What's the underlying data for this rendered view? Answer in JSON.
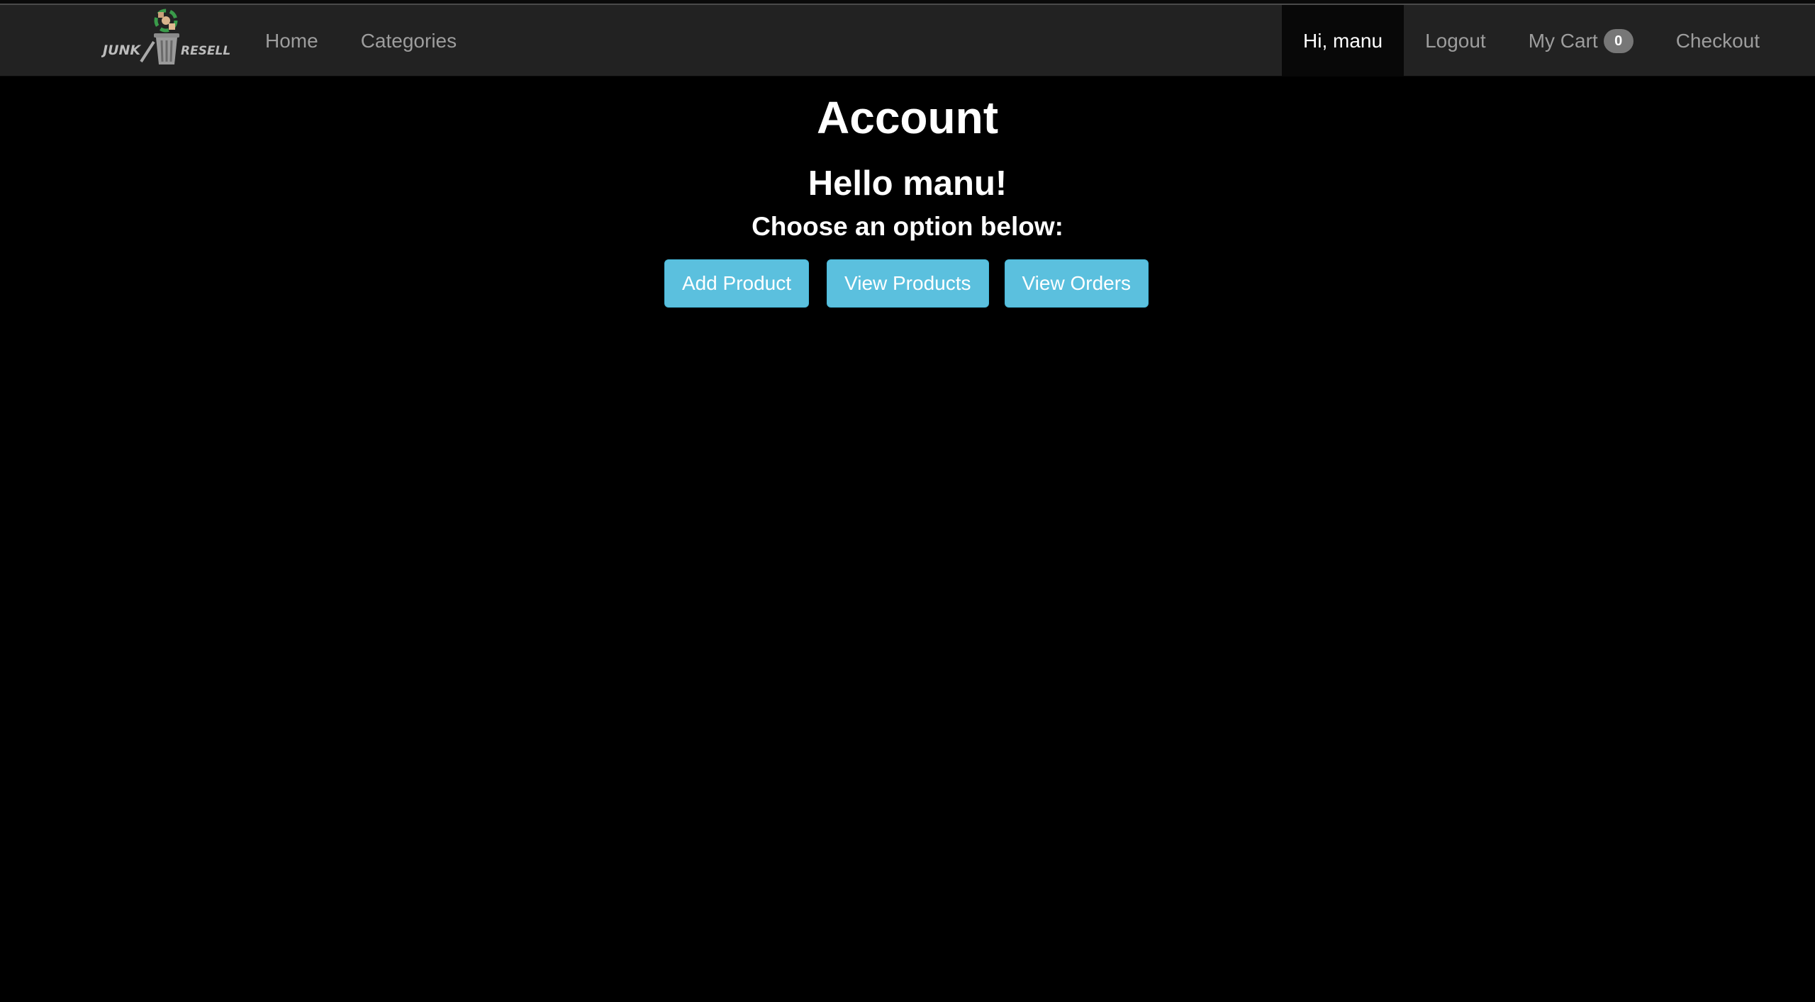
{
  "brand": {
    "logo_text_left": "JUNK",
    "logo_text_right": "RESELL"
  },
  "nav": {
    "left": [
      {
        "label": "Home"
      },
      {
        "label": "Categories"
      }
    ],
    "greeting": "Hi, manu",
    "logout": "Logout",
    "cart_label": "My Cart",
    "cart_count": "0",
    "checkout": "Checkout"
  },
  "main": {
    "title": "Account",
    "hello": "Hello manu!",
    "prompt": "Choose an option below:",
    "buttons": [
      {
        "label": "Add Product"
      },
      {
        "label": "View Products"
      },
      {
        "label": "View Orders"
      }
    ]
  },
  "colors": {
    "navbar_bg": "#222222",
    "page_bg": "#000000",
    "button_info": "#5bc0de",
    "nav_text": "#9d9d9d",
    "active_bg": "#080808",
    "badge": "#777777"
  }
}
